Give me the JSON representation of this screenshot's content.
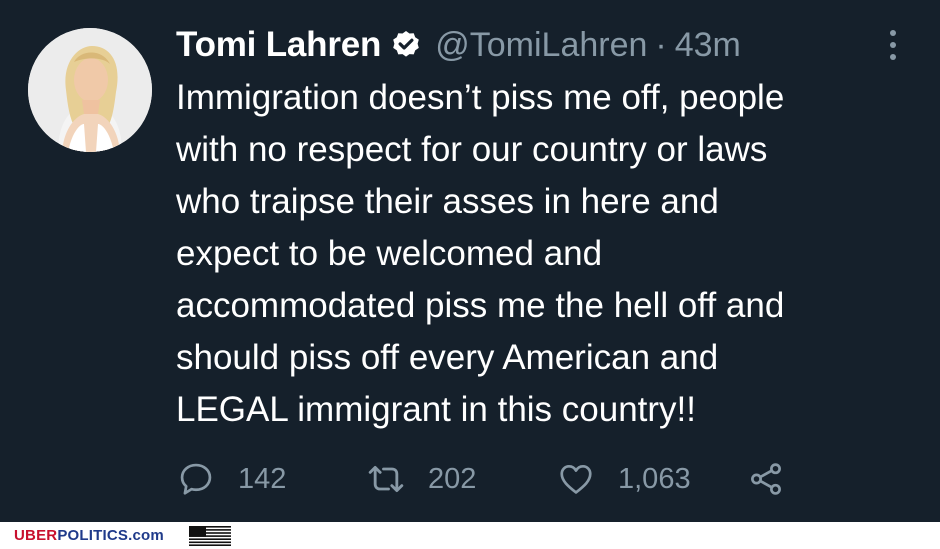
{
  "tweet": {
    "display_name": "Tomi Lahren",
    "handle": "@TomiLahren",
    "separator": "·",
    "time": "43m",
    "body_lines": [
      "Immigration doesn’t piss me off, people",
      "with no respect for our country or laws",
      "who traipse their asses in here and",
      "expect to be welcomed and",
      "accommodated piss me the hell off and",
      "should piss off every American and",
      "LEGAL immigrant in this country!!"
    ],
    "stats": {
      "replies": "142",
      "retweets": "202",
      "likes": "1,063"
    },
    "icons": {
      "avatar": "profile-photo",
      "verified": "verified-badge-icon",
      "more": "more-vertical-icon",
      "reply": "reply-bubble-icon",
      "retweet": "retweet-icon",
      "like": "heart-icon",
      "share": "share-icon"
    }
  },
  "footer": {
    "brand_part1": "UBER",
    "brand_part2": "POLITICS.com",
    "flag": "us-flag-icon"
  },
  "colors": {
    "background": "#15202b",
    "text_primary": "#ffffff",
    "text_secondary": "#8899a6",
    "brand_red": "#c8102e",
    "brand_blue": "#1f3a8a"
  }
}
